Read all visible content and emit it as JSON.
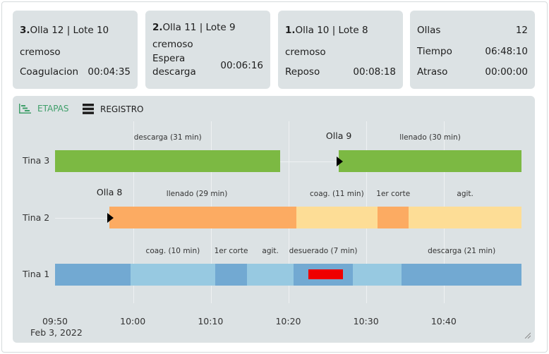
{
  "cards": [
    {
      "num": "3.",
      "title": "Olla 12 | Lote 10",
      "type": "cremoso",
      "stage": "Coagulacion",
      "time": "00:04:35"
    },
    {
      "num": "2.",
      "title": "Olla 11 | Lote 9",
      "type": "cremoso",
      "stage_line1": "Espera",
      "stage_line2": "descarga",
      "time": "00:06:16"
    },
    {
      "num": "1.",
      "title": "Olla 10 | Lote 8",
      "type": "cremoso",
      "stage": "Reposo",
      "time": "00:08:18"
    }
  ],
  "summary": {
    "ollas_label": "Ollas",
    "ollas_value": "12",
    "tiempo_label": "Tiempo",
    "tiempo_value": "06:48:10",
    "atraso_label": "Atraso",
    "atraso_value": "00:00:00"
  },
  "tabs": {
    "etapas": "ETAPAS",
    "registro": "REGISTRO"
  },
  "chart_data": {
    "type": "gantt",
    "x_start": "09:50",
    "date_label": "Feb 3, 2022",
    "tick_labels": [
      "09:50",
      "10:00",
      "10:10",
      "10:20",
      "10:30",
      "10:40"
    ],
    "rows": [
      {
        "name": "Tina 3",
        "segments": [
          {
            "start_min": 0,
            "end_min": 29,
            "color": "#7cb943",
            "label": "descarga (31 min)"
          },
          {
            "start_min": 36.5,
            "end_min": 60,
            "color": "#7cb943",
            "label": "llenado (30 min)"
          }
        ],
        "olla_markers": [
          {
            "at_min": 36.5,
            "label": "Olla 9"
          }
        ]
      },
      {
        "name": "Tina 2",
        "segments": [
          {
            "start_min": 7,
            "end_min": 29.5,
            "color": "#fcab62",
            "label": "llenado (29 min)"
          },
          {
            "start_min": 29.5,
            "end_min": 31,
            "color": "#fcab62",
            "label": ""
          },
          {
            "start_min": 31,
            "end_min": 41.5,
            "color": "#fddd96",
            "label": "coag. (11 min)"
          },
          {
            "start_min": 41.5,
            "end_min": 45.5,
            "color": "#fcab62",
            "label": "1er corte"
          },
          {
            "start_min": 45.5,
            "end_min": 60,
            "color": "#fddd96",
            "label": "agit."
          }
        ],
        "olla_markers": [
          {
            "at_min": 7,
            "label": "Olla 8"
          }
        ]
      },
      {
        "name": "Tina 1",
        "segments": [
          {
            "start_min": 0,
            "end_min": 6.5,
            "color": "#72a9d2",
            "label": ""
          },
          {
            "start_min": 6.5,
            "end_min": 9.7,
            "color": "#72a9d2",
            "label": ""
          },
          {
            "start_min": 9.7,
            "end_min": 20.6,
            "color": "#97c9e1",
            "label": "coag. (10 min)"
          },
          {
            "start_min": 20.6,
            "end_min": 24.7,
            "color": "#72a9d2",
            "label": "1er corte"
          },
          {
            "start_min": 24.7,
            "end_min": 30.7,
            "color": "#97c9e1",
            "label": "agit."
          },
          {
            "start_min": 30.7,
            "end_min": 38.3,
            "color": "#72a9d2",
            "label": "desuerado (7 min)"
          },
          {
            "start_min": 38.3,
            "end_min": 44.6,
            "color": "#97c9e1",
            "label": ""
          },
          {
            "start_min": 44.6,
            "end_min": 60,
            "color": "#72a9d2",
            "label": "descarga (21 min)"
          }
        ],
        "current_time_min": 34.5,
        "current_color": "#ef0000"
      }
    ]
  }
}
